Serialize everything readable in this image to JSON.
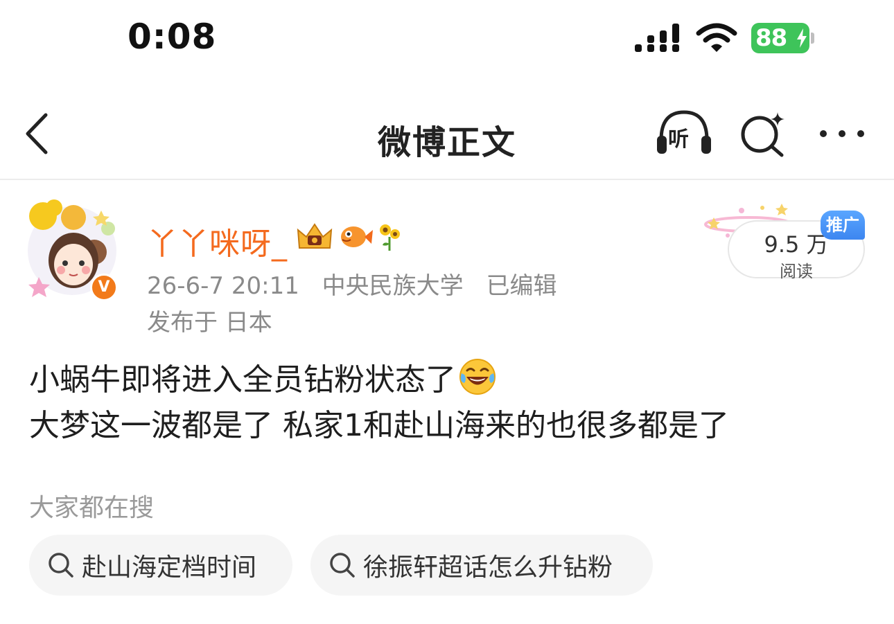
{
  "status_bar": {
    "time": "0:08",
    "battery": "88",
    "icons": [
      "cellular-signal-icon",
      "wifi-icon",
      "battery-charging-icon"
    ]
  },
  "nav": {
    "title": "微博正文",
    "listen_label": "听",
    "icons": [
      "back-arrow-icon",
      "listen-headphones-icon",
      "search-sparkle-icon",
      "more-dots-icon"
    ]
  },
  "post": {
    "username": "丫丫咪呀_",
    "timestamp": "26-6-7 20:11",
    "source": "中央民族大学",
    "edited": "已编辑",
    "location": "发布于 日本",
    "verified_label": "V",
    "reads": {
      "count": "9.5 万",
      "label": "阅读",
      "promo": "推广"
    },
    "content": {
      "line1": "小蜗牛即将进入全员钻粉状态了",
      "line2": "大梦这一波都是了 私家1和赴山海来的也很多都是了",
      "emoji": "laughing-tears-emoji"
    }
  },
  "search_section": {
    "title": "大家都在搜",
    "chips": [
      {
        "label": "赴山海定档时间"
      },
      {
        "label": "徐振轩超话怎么升钻粉"
      }
    ]
  },
  "colors": {
    "username": "#f46a1e",
    "battery": "#3ec45a",
    "promo": "#3d86f0",
    "meta": "#8a8a8a"
  }
}
